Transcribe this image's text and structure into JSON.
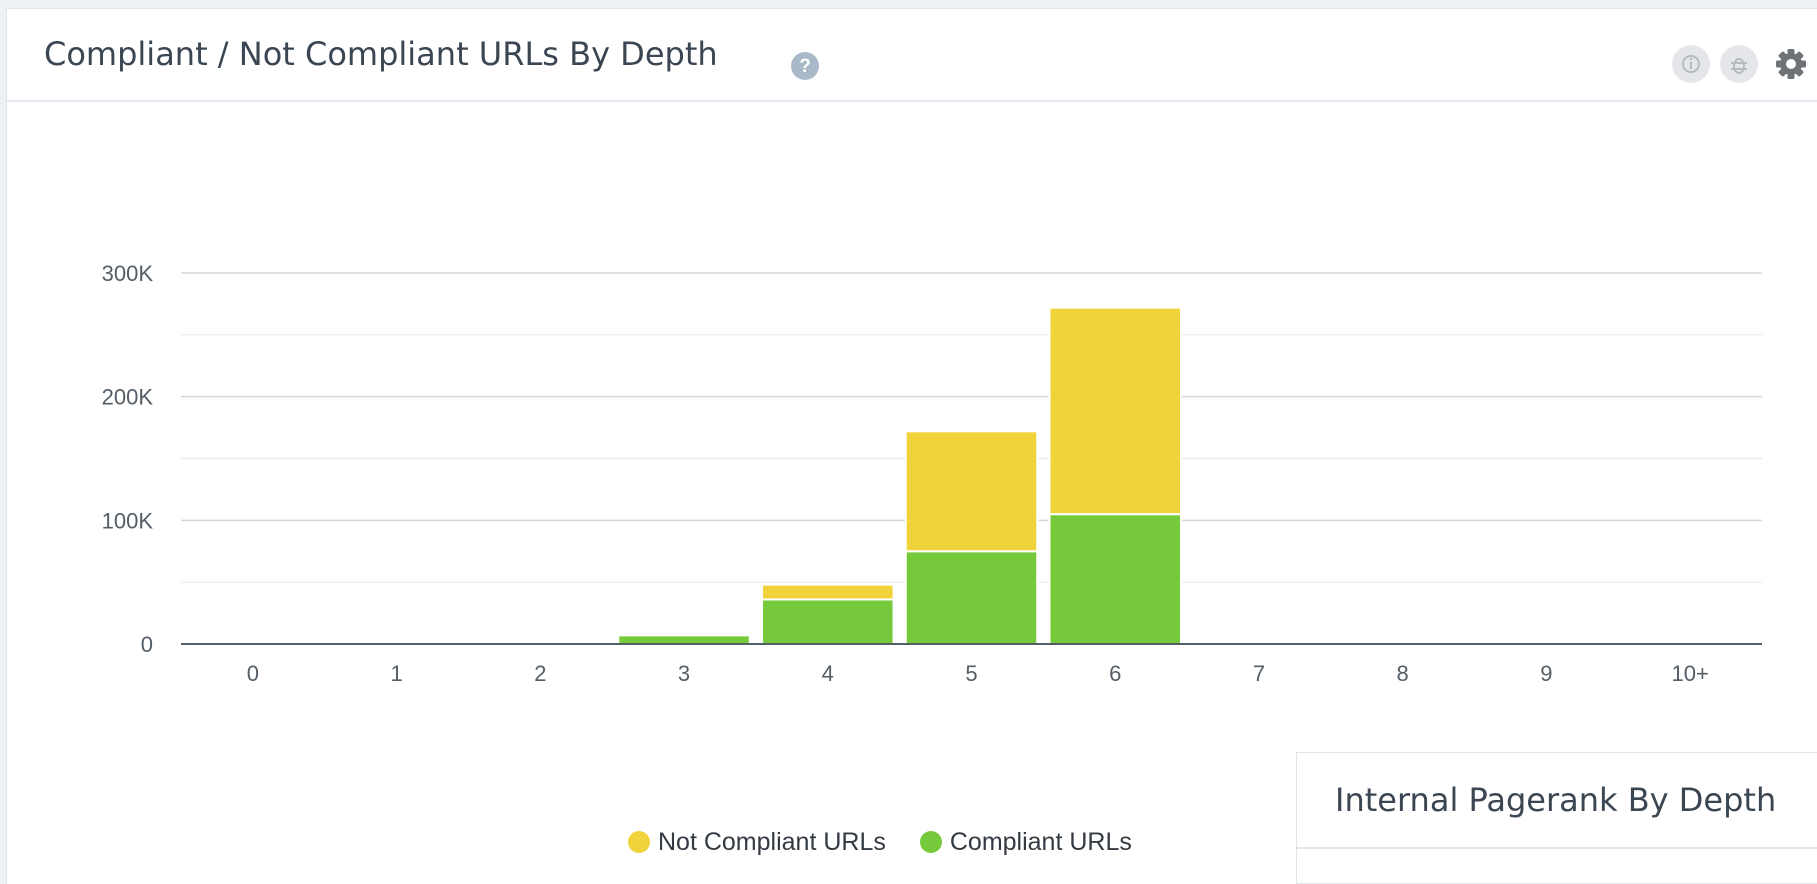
{
  "panel": {
    "title": "Compliant / Not Compliant URLs By Depth",
    "help_icon": "question-circle-icon",
    "header_icons": [
      "info-icon",
      "bug-icon",
      "gear-icon"
    ]
  },
  "chart_data": {
    "type": "bar",
    "stacked": true,
    "categories": [
      "0",
      "1",
      "2",
      "3",
      "4",
      "5",
      "6",
      "7",
      "8",
      "9",
      "10+"
    ],
    "series": [
      {
        "name": "Compliant URLs",
        "color": "#76c93b",
        "values": [
          0,
          0,
          0,
          7000,
          36000,
          75000,
          105000,
          0,
          0,
          0,
          0
        ]
      },
      {
        "name": "Not Compliant URLs",
        "color": "#f0d23a",
        "values": [
          0,
          0,
          0,
          0,
          12000,
          97000,
          167000,
          0,
          0,
          0,
          0
        ]
      }
    ],
    "title": "",
    "xlabel": "",
    "ylabel": "",
    "ylim": [
      0,
      300000
    ],
    "yticks": [
      0,
      100000,
      200000,
      300000
    ],
    "ytick_labels": [
      "0",
      "100K",
      "200K",
      "300K"
    ],
    "grid": true,
    "legend": {
      "placement": "bottom-center",
      "entries": [
        "Not Compliant URLs",
        "Compliant URLs"
      ]
    }
  },
  "legend": {
    "items": [
      {
        "label": "Not Compliant URLs",
        "color": "#f0d23a"
      },
      {
        "label": "Compliant URLs",
        "color": "#76c93b"
      }
    ]
  },
  "panel2": {
    "title": "Internal Pagerank By Depth"
  }
}
